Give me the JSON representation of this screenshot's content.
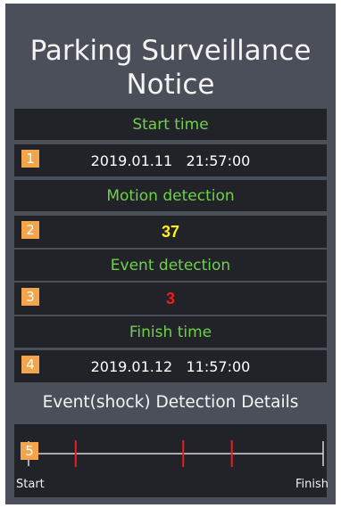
{
  "notice": {
    "title_line1": "Parking Surveillance",
    "title_line2": "Notice"
  },
  "sections": {
    "start_time": {
      "label": "Start time",
      "badge": "1",
      "value": "2019.01.11   21:57:00"
    },
    "motion_detection": {
      "label": "Motion detection",
      "badge": "2",
      "value": "37",
      "value_color": "#ffef1a"
    },
    "event_detection": {
      "label": "Event detection",
      "badge": "3",
      "value": "3",
      "value_color": "#f01c1c"
    },
    "finish_time": {
      "label": "Finish time",
      "badge": "4",
      "value": "2019.01.12   11:57:00"
    }
  },
  "details": {
    "title": "Event(shock) Detection Details",
    "badge": "5",
    "start_label": "Start",
    "finish_label": "Finish",
    "event_positions": [
      0.16,
      0.525,
      0.69
    ],
    "event_color": "#f01c1c"
  }
}
